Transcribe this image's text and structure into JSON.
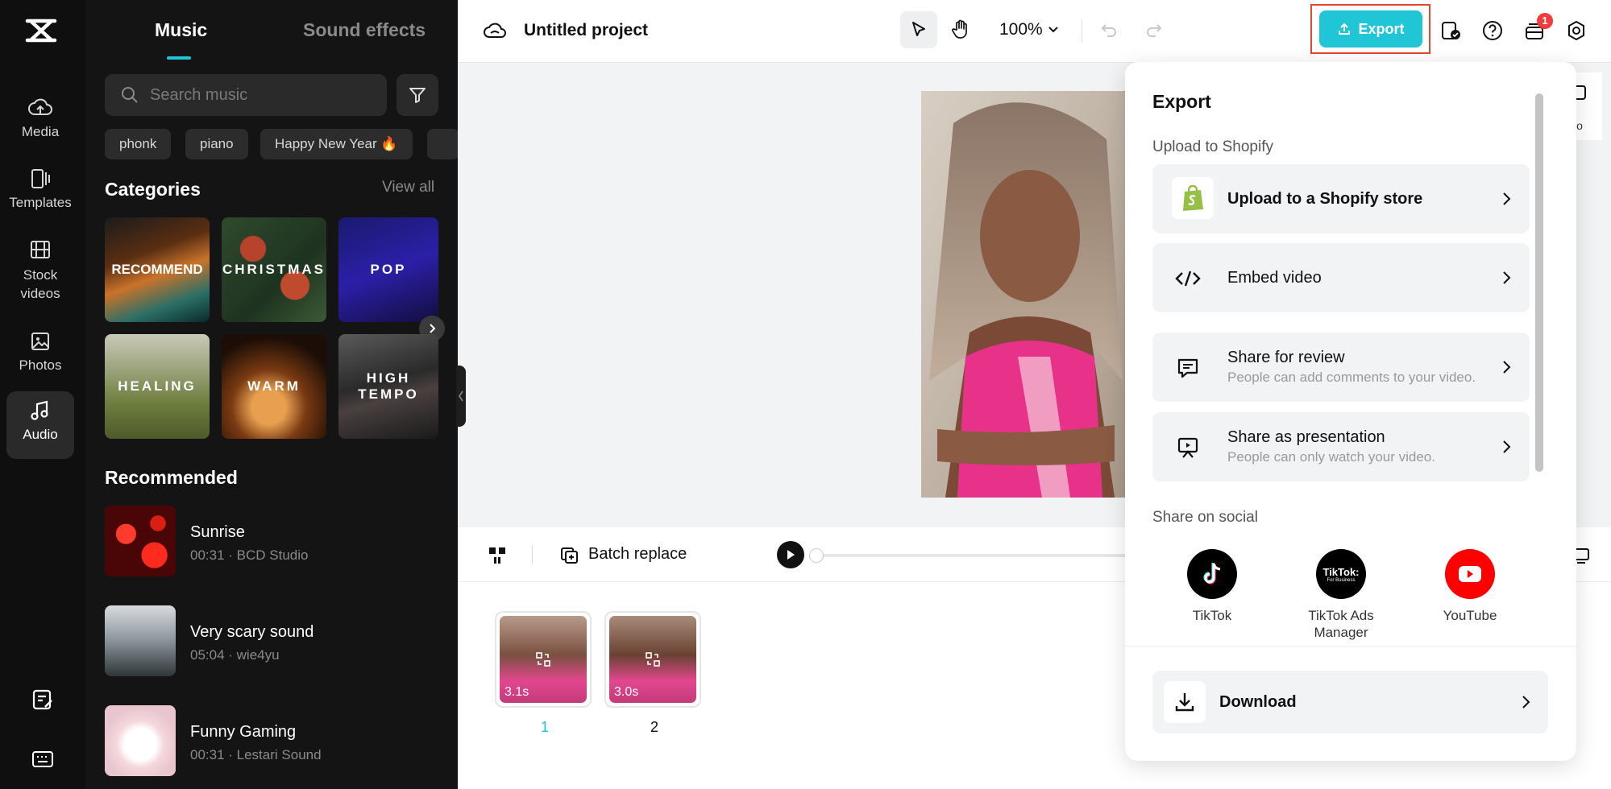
{
  "rail": {
    "items": [
      {
        "label": "Media",
        "icon": "cloud-upload-icon"
      },
      {
        "label": "Templates",
        "icon": "template-icon"
      },
      {
        "label": "Stock videos",
        "icon": "film-icon"
      },
      {
        "label": "Photos",
        "icon": "image-icon"
      },
      {
        "label": "Audio",
        "icon": "music-note-icon",
        "active": true
      }
    ]
  },
  "music_panel": {
    "tabs": [
      "Music",
      "Sound effects"
    ],
    "search_placeholder": "Search music",
    "chips": [
      "phonk",
      "piano",
      "Happy New Year 🔥"
    ],
    "categories_title": "Categories",
    "view_all": "View all",
    "categories": [
      "RECOMMEND",
      "CHRISTMAS",
      "POP",
      "HEALING",
      "WARM",
      "HIGH TEMPO"
    ],
    "recommended_title": "Recommended",
    "tracks": [
      {
        "title": "Sunrise",
        "meta": "00:31 · BCD Studio"
      },
      {
        "title": "Very scary sound",
        "meta": "05:04 · wie4yu"
      },
      {
        "title": "Funny Gaming",
        "meta": "00:31 · Lestari Sound"
      }
    ]
  },
  "topbar": {
    "project_title": "Untitled project",
    "zoom": "100%",
    "export_label": "Export",
    "notification_count": "1"
  },
  "timeline": {
    "batch_replace": "Batch replace",
    "clips": [
      {
        "duration": "3.1s",
        "number": "1"
      },
      {
        "duration": "3.0s",
        "number": "2"
      }
    ]
  },
  "export_popup": {
    "title": "Export",
    "upload_section": "Upload to Shopify",
    "options": [
      {
        "title": "Upload to a Shopify store",
        "icon": "shopify-icon"
      },
      {
        "title": "Embed video",
        "icon": "code-icon"
      },
      {
        "title": "Share for review",
        "desc": "People can add comments to your video.",
        "icon": "comment-icon"
      },
      {
        "title": "Share as presentation",
        "desc": "People can only watch your video.",
        "icon": "presentation-icon"
      }
    ],
    "social_section": "Share on social",
    "social": [
      {
        "name": "TikTok"
      },
      {
        "name": "TikTok Ads Manager",
        "logo_text": "TikTok:",
        "logo_sub": "For Business"
      },
      {
        "name": "YouTube"
      }
    ],
    "download": "Download"
  },
  "side_panel_text": "io",
  "colors": {
    "accent": "#21c6d6",
    "highlight": "#e8462c",
    "shopify": "#95bf47",
    "youtube": "#ff0000"
  }
}
